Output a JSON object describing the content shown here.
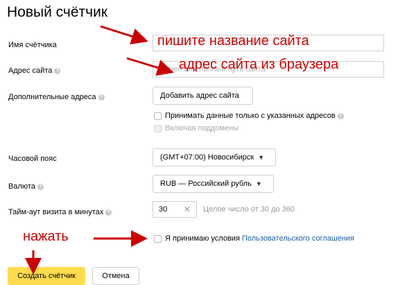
{
  "page": {
    "title": "Новый счётчик"
  },
  "fields": {
    "counter_name": {
      "label": "Имя счётчика",
      "value": ""
    },
    "site_address": {
      "label": "Адрес сайта",
      "placeholder": "Домен или полный путь сайта"
    },
    "additional_addresses": {
      "label": "Дополнительные адреса",
      "button": "Добавить адрес сайта"
    },
    "accept_only_specified": {
      "label": "Принимать данные только с указанных адресов"
    },
    "include_subdomains": {
      "label": "Включая поддомены"
    },
    "timezone": {
      "label": "Часовой пояс",
      "value": "(GMT+07:00) Новосибирск"
    },
    "currency": {
      "label": "Валюта",
      "value": "RUB — Российский рубль"
    },
    "timeout": {
      "label": "Тайм-аут визита в минутах",
      "value": "30",
      "hint": "Целое число от 30 до 360"
    },
    "agreement": {
      "label_prefix": "Я принимаю условия",
      "link": "Пользовательского соглашения"
    }
  },
  "actions": {
    "create": "Создать счётчик",
    "cancel": "Отмена"
  },
  "annotations": {
    "write_site_name": "пишите название сайта",
    "site_address_from_browser": "адрес сайта из браузера",
    "press": "нажать"
  },
  "colors": {
    "annotation": "#cc0000",
    "primary_button": "#ffdb4d",
    "link": "#1f5fa8"
  }
}
